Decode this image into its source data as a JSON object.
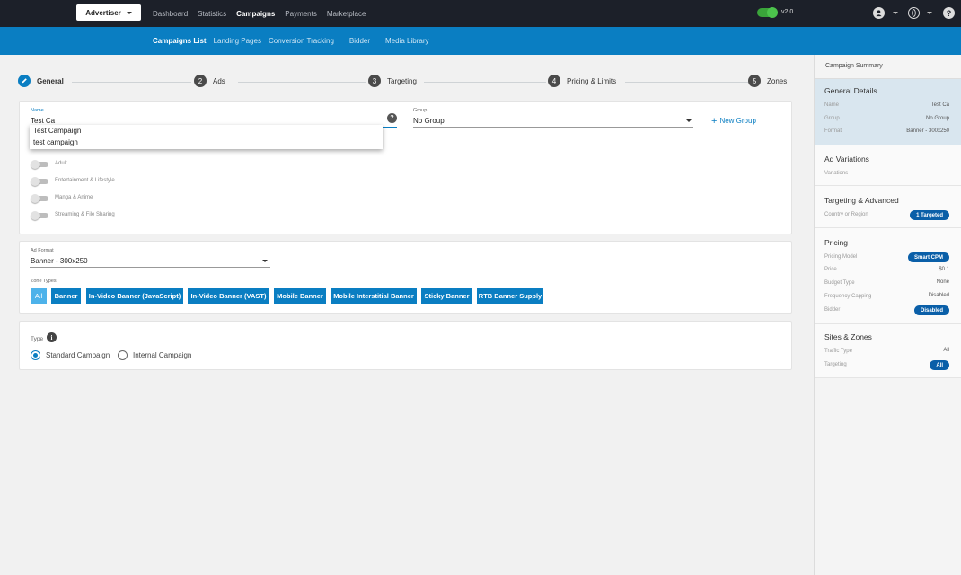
{
  "topbar": {
    "role_button": "Advertiser",
    "nav": [
      "Dashboard",
      "Statistics",
      "Campaigns",
      "Payments",
      "Marketplace"
    ],
    "active_nav": "Campaigns",
    "version": "v2.0",
    "icons": [
      "user-icon",
      "globe-icon",
      "help-icon"
    ]
  },
  "subnav": {
    "items": [
      "Campaigns List",
      "Landing Pages",
      "Conversion Tracking",
      "Bidder",
      "Media Library"
    ],
    "active": "Campaigns List"
  },
  "steps": [
    {
      "num": "",
      "label": "General",
      "icon": "pencil-icon"
    },
    {
      "num": "2",
      "label": "Ads"
    },
    {
      "num": "3",
      "label": "Targeting"
    },
    {
      "num": "4",
      "label": "Pricing & Limits"
    },
    {
      "num": "5",
      "label": "Zones"
    }
  ],
  "general": {
    "name_label": "Name",
    "name_value": "Test Ca",
    "group_label": "Group",
    "group_value": "No Group",
    "new_group": "New Group",
    "suggestions": [
      "Test Campaign",
      "test campaign"
    ],
    "categories": [
      "Adult",
      "Entertainment & Lifestyle",
      "Manga & Anime",
      "Streaming & File Sharing"
    ]
  },
  "ad_format": {
    "label": "Ad Format",
    "value": "Banner - 300x250",
    "zone_types_label": "Zone Types",
    "zone_types": [
      "All",
      "Banner",
      "In-Video Banner (JavaScript)",
      "In-Video Banner (VAST)",
      "Mobile Banner",
      "Mobile Interstitial Banner",
      "Sticky Banner",
      "RTB Banner Supply"
    ]
  },
  "type": {
    "label": "Type",
    "options": [
      "Standard Campaign",
      "Internal Campaign"
    ],
    "selected": "Standard Campaign"
  },
  "summary": {
    "title": "Campaign Summary",
    "general": {
      "heading": "General Details",
      "rows": [
        {
          "k": "Name",
          "v": "Test Ca"
        },
        {
          "k": "Group",
          "v": "No Group"
        },
        {
          "k": "Format",
          "v": "Banner - 300x250"
        }
      ]
    },
    "ad_variations": {
      "heading": "Ad Variations",
      "rows": [
        {
          "k": "Variations",
          "v": ""
        }
      ]
    },
    "targeting": {
      "heading": "Targeting & Advanced",
      "rows": [
        {
          "k": "Country or Region",
          "v": "1 Targeted"
        }
      ]
    },
    "pricing": {
      "heading": "Pricing",
      "rows": [
        {
          "k": "Pricing Model",
          "v": "Smart CPM"
        },
        {
          "k": "Price",
          "v": "$0.1"
        },
        {
          "k": "Budget Type",
          "v": "None"
        },
        {
          "k": "Frequency Capping",
          "v": "Disabled"
        },
        {
          "k": "Bidder",
          "v": "Disabled"
        }
      ]
    },
    "sites": {
      "heading": "Sites & Zones",
      "rows": [
        {
          "k": "Traffic Type",
          "v": "All"
        },
        {
          "k": "Targeting",
          "v": "All"
        }
      ]
    }
  },
  "colors": {
    "brand": "#0a7ec2",
    "topbar": "#1c2029",
    "toggle_on": "#3aa43a",
    "pill": "#0a5fa8"
  }
}
